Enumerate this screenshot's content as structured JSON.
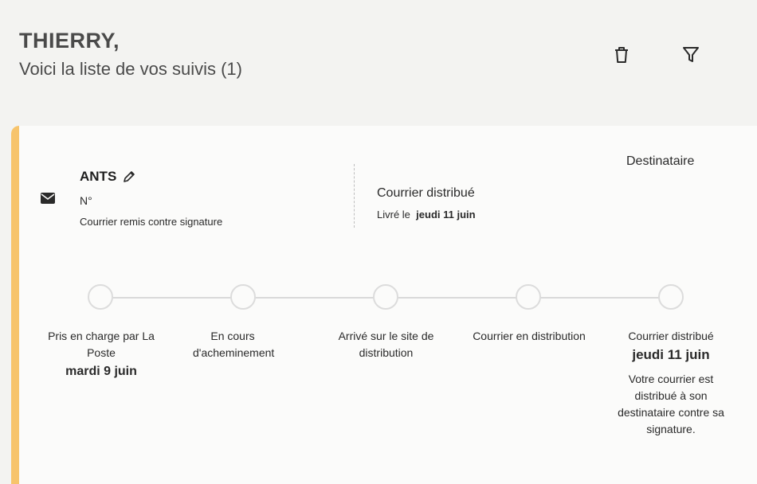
{
  "header": {
    "name": "THIERRY,",
    "subtitle": "Voici la liste de vos suivis (1)",
    "icons": [
      "trash-icon",
      "filter-icon"
    ]
  },
  "card": {
    "accent_color": "#f7c46c",
    "icon": "envelope-icon",
    "sender": "ANTS",
    "number_label": "N°",
    "service": "Courrier remis contre signature",
    "status_title": "Courrier distribué",
    "status_prefix": "Livré le",
    "status_date": "jeudi 11 juin",
    "recipient_label": "Destinataire"
  },
  "timeline": {
    "steps": [
      {
        "label": "Pris en charge par La Poste",
        "date": "mardi 9 juin"
      },
      {
        "label": "En cours d'acheminement"
      },
      {
        "label": "Arrivé sur le site de distribution"
      },
      {
        "label": "Courrier en distribution"
      },
      {
        "label": "Courrier distribué",
        "date": "jeudi 11 juin",
        "description": "Votre courrier est distribué à son destinataire contre sa signature."
      }
    ]
  }
}
